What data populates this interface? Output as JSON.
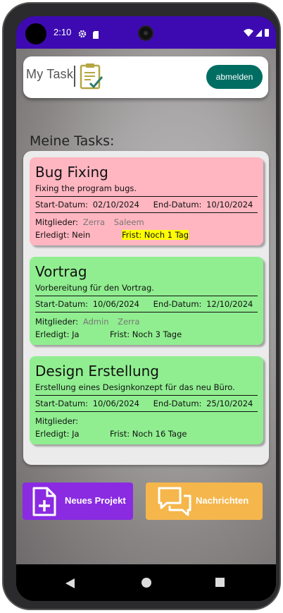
{
  "status_bar": {
    "time": "2:10"
  },
  "header": {
    "logo_text": "My Task",
    "logout_label": "abmelden"
  },
  "section_title": "Meine Tasks:",
  "tasks": [
    {
      "title": "Bug Fixing",
      "description": "Fixing the program bugs.",
      "start_label": "Start-Datum:",
      "start_date": "02/10/2024",
      "end_label": "End-Datum:",
      "end_date": "10/10/2024",
      "members_label": "Mitglieder:",
      "members": [
        "Zerra",
        "Saleem"
      ],
      "done_label": "Erledigt:",
      "done_value": "Nein",
      "deadline_label": "Frist:",
      "deadline_value": "Noch 1 Tag",
      "status_color": "#ffb6c1"
    },
    {
      "title": "Vortrag",
      "description": "Vorbereitung für den Vortrag.",
      "start_label": "Start-Datum:",
      "start_date": "10/06/2024",
      "end_label": "End-Datum:",
      "end_date": "12/10/2024",
      "members_label": "Mitglieder:",
      "members": [
        "Admin",
        "Zerra"
      ],
      "done_label": "Erledigt:",
      "done_value": "Ja",
      "deadline_label": "Frist:",
      "deadline_value": "Noch 3 Tage",
      "status_color": "#90ee90"
    },
    {
      "title": "Design Erstellung",
      "description": "Erstellung eines Designkonzept für das neu Büro.",
      "start_label": "Start-Datum:",
      "start_date": "10/06/2024",
      "end_label": "End-Datum:",
      "end_date": "25/10/2024",
      "members_label": "Mitglieder:",
      "members": [],
      "done_label": "Erledigt:",
      "done_value": "Ja",
      "deadline_label": "Frist:",
      "deadline_value": "Noch 16 Tage",
      "status_color": "#90ee90"
    }
  ],
  "actions": {
    "new_project_label": "Neues Projekt",
    "messages_label": "Nachrichten"
  },
  "colors": {
    "status_bar": "#3d0ab1",
    "logout_button": "#006d62",
    "new_project_button": "#8a2be2",
    "messages_button": "#f5b64b",
    "deadline_highlight": "#ffff00"
  },
  "icons": {
    "status": [
      "gear-icon",
      "sd-card-icon",
      "wifi-icon",
      "signal-icon",
      "battery-icon"
    ],
    "nav": [
      "back-icon",
      "home-icon",
      "recent-apps-icon"
    ],
    "buttons": [
      "add-document-icon",
      "chat-bubbles-icon"
    ]
  }
}
